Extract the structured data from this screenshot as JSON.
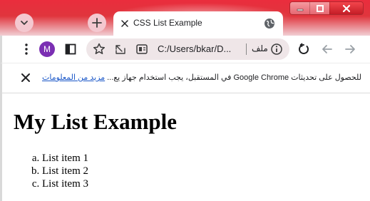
{
  "browser": {
    "tab": {
      "title": "CSS List Example",
      "favicon": "globe-icon"
    },
    "buttons": {
      "tab_search": "chevron-down-icon",
      "new_tab": "plus-icon"
    },
    "window_controls": [
      "minimize-icon",
      "maximize-icon",
      "close-icon"
    ],
    "colors": {
      "frame": "#e0353d",
      "omnibox_bg": "#efe6e8",
      "avatar": "#7b2fb3",
      "link": "#1a57c8"
    }
  },
  "toolbar": {
    "profile_initial": "M",
    "address": "C:/Users/bkar/D...",
    "file_label": "ملف",
    "icons": [
      "more-vert-icon",
      "side-panel-icon",
      "bookmark-star-icon",
      "share-icon",
      "install-app-icon",
      "site-info-icon",
      "reload-icon",
      "back-icon",
      "forward-icon"
    ]
  },
  "infobar": {
    "message": "للحصول على تحديثات Google Chrome في المستقبل، يجب استخدام جهاز يع...",
    "link": "مزيد من المعلومات",
    "close_icon": "close-icon"
  },
  "page": {
    "heading": "My List Example",
    "list_items": [
      "List item 1",
      "List item 2",
      "List item 3"
    ]
  }
}
